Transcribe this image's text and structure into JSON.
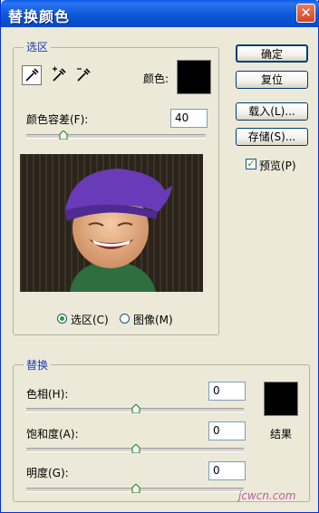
{
  "window": {
    "title": "替换颜色",
    "close_glyph": "✕"
  },
  "selection_group": {
    "label": "选区",
    "color_label": "颜色:",
    "color_swatch": "#000000",
    "tolerance_label": "颜色容差(F):",
    "tolerance_value": "40",
    "tolerance_fraction": 0.2,
    "tools": [
      "eyedropper-icon",
      "eyedropper-plus-icon",
      "eyedropper-minus-icon"
    ],
    "view_options": [
      {
        "label": "选区(C)",
        "selected": true
      },
      {
        "label": "图像(M)",
        "selected": false
      }
    ]
  },
  "buttons": {
    "ok": "确定",
    "reset": "复位",
    "load": "载入(L)...",
    "save": "存储(S)..."
  },
  "preview": {
    "label": "预览(P)",
    "checked": true
  },
  "replace_group": {
    "label": "替换",
    "hue_label": "色相(H):",
    "hue_value": "0",
    "saturation_label": "饱和度(A):",
    "saturation_value": "0",
    "lightness_label": "明度(G):",
    "lightness_value": "0",
    "result_label": "结果",
    "result_swatch": "#000000"
  },
  "watermark": "jcwcn.com"
}
